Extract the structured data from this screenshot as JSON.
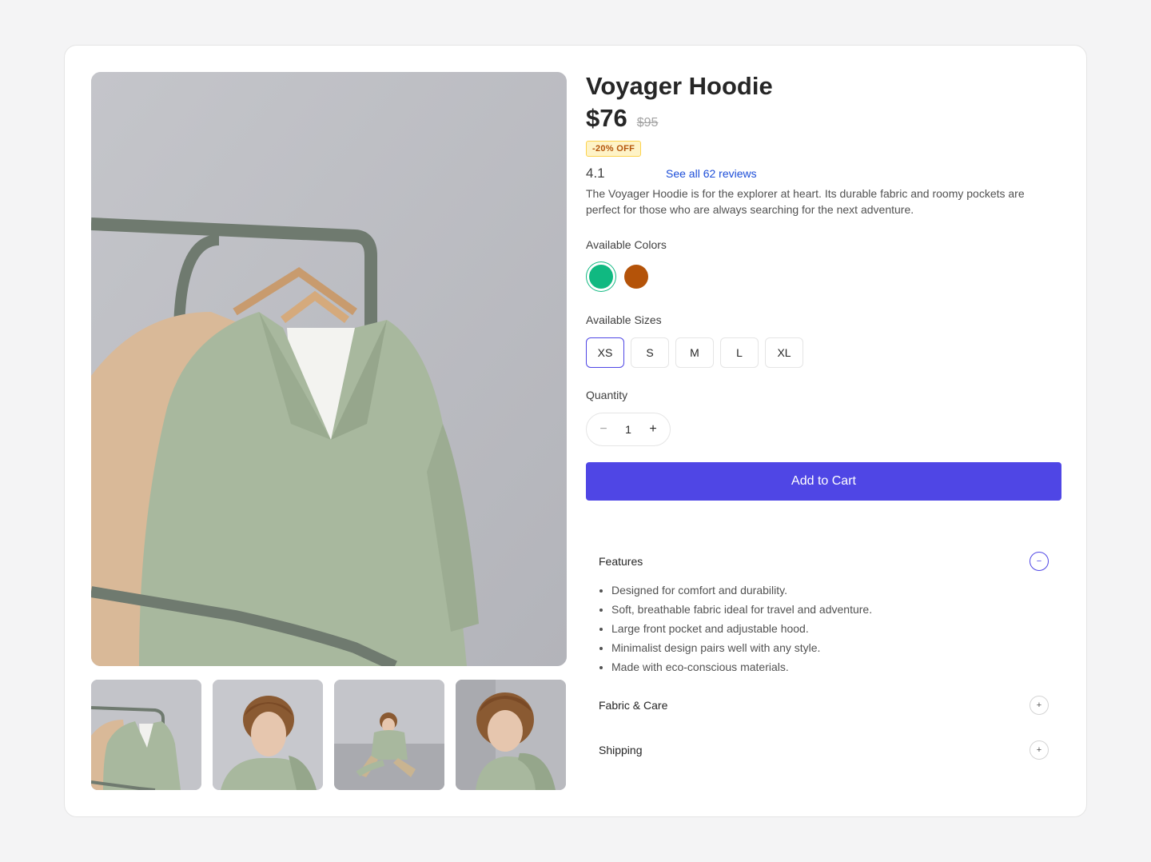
{
  "product": {
    "title": "Voyager Hoodie",
    "price": "$76",
    "original_price": "$95",
    "discount_badge": "-20% OFF",
    "rating": "4.1",
    "reviews_link": "See all 62 reviews",
    "description": "The Voyager Hoodie is for the explorer at heart. Its durable fabric and roomy pockets are perfect for those who are always searching for the next adventure."
  },
  "colors": {
    "label": "Available Colors",
    "options": [
      {
        "name": "green",
        "hex": "#10b981",
        "selected": true
      },
      {
        "name": "orange",
        "hex": "#b45309",
        "selected": false
      }
    ]
  },
  "sizes": {
    "label": "Available Sizes",
    "options": [
      "XS",
      "S",
      "M",
      "L",
      "XL"
    ],
    "selected": "XS"
  },
  "quantity": {
    "label": "Quantity",
    "value": "1",
    "decrement": "−",
    "increment": "+"
  },
  "cart": {
    "button_label": "Add to Cart"
  },
  "accordion": {
    "features": {
      "title": "Features",
      "icon": "−",
      "items": [
        "Designed for comfort and durability.",
        "Soft, breathable fabric ideal for travel and adventure.",
        "Large front pocket and adjustable hood.",
        "Minimalist design pairs well with any style.",
        "Made with eco-conscious materials."
      ]
    },
    "fabric_care": {
      "title": "Fabric & Care",
      "icon": "+"
    },
    "shipping": {
      "title": "Shipping",
      "icon": "+"
    }
  },
  "theme": {
    "accent": "#4f46e5",
    "link": "#1d4ed8",
    "badge_bg": "#fef3c7",
    "badge_text": "#b45309"
  }
}
